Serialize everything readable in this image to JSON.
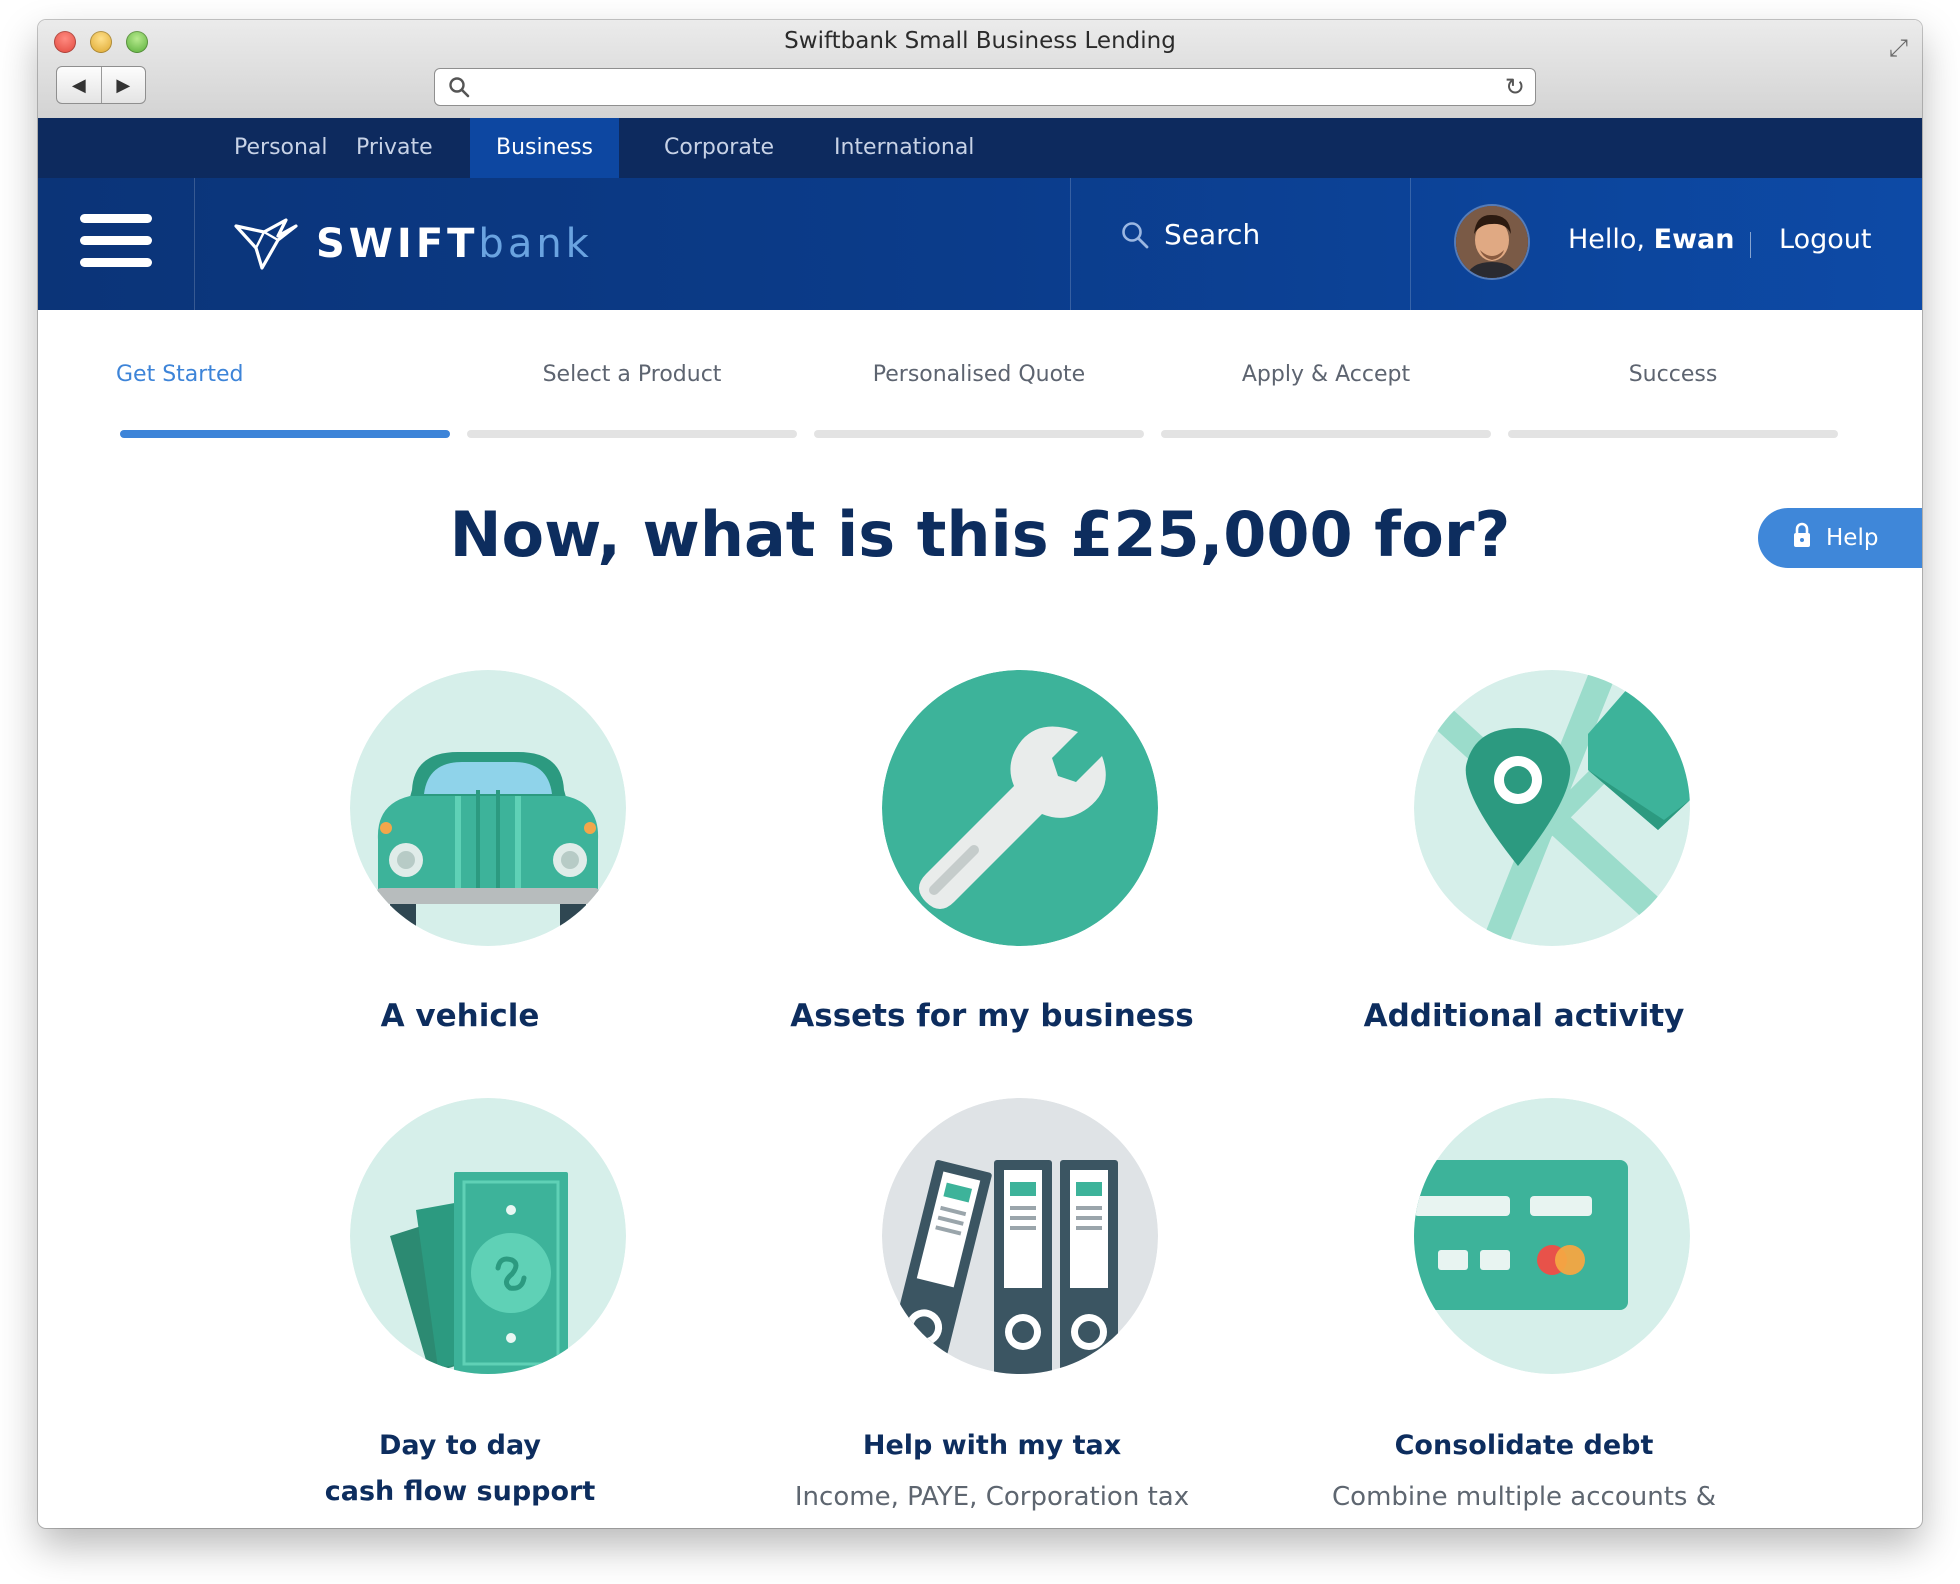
{
  "browser": {
    "window_title": "Swiftbank Small Business Lending",
    "url": ""
  },
  "topnav": {
    "items": [
      {
        "label": "Personal"
      },
      {
        "label": "Private"
      },
      {
        "label": "Business"
      },
      {
        "label": "Corporate"
      },
      {
        "label": "International"
      }
    ],
    "active": "Business"
  },
  "header": {
    "logo_primary": "SWIFT",
    "logo_secondary": "bank",
    "search_label": "Search",
    "greeting": "Hello,",
    "user_name": "Ewan",
    "logout_label": "Logout"
  },
  "steps": {
    "items": [
      {
        "label": "Get Started"
      },
      {
        "label": "Select a Product"
      },
      {
        "label": "Personalised Quote"
      },
      {
        "label": "Apply & Accept"
      },
      {
        "label": "Success"
      }
    ],
    "active": "Get Started"
  },
  "main": {
    "heading": "Now, what is this £25,000 for?",
    "help_label": "Help",
    "options": [
      {
        "title": "A vehicle",
        "icon": "car-icon"
      },
      {
        "title": "Assets for my business",
        "icon": "wrench-icon"
      },
      {
        "title": "Additional activity",
        "icon": "map-pin-icon"
      },
      {
        "title_line1": "Day to day",
        "title_line2": "cash flow support",
        "icon": "cash-icon"
      },
      {
        "title": "Help with my tax",
        "subtitle": "Income, PAYE, Corporation tax",
        "icon": "binders-icon"
      },
      {
        "title": "Consolidate debt",
        "subtitle": "Combine multiple accounts &",
        "icon": "credit-card-icon"
      }
    ]
  },
  "colors": {
    "navy": "#0d2a5e",
    "brand_blue": "#0d47a1",
    "accent_blue": "#3d84d8",
    "teal": "#3db39a",
    "light_teal": "#d6efea",
    "heading_text": "#0d2d5e"
  }
}
